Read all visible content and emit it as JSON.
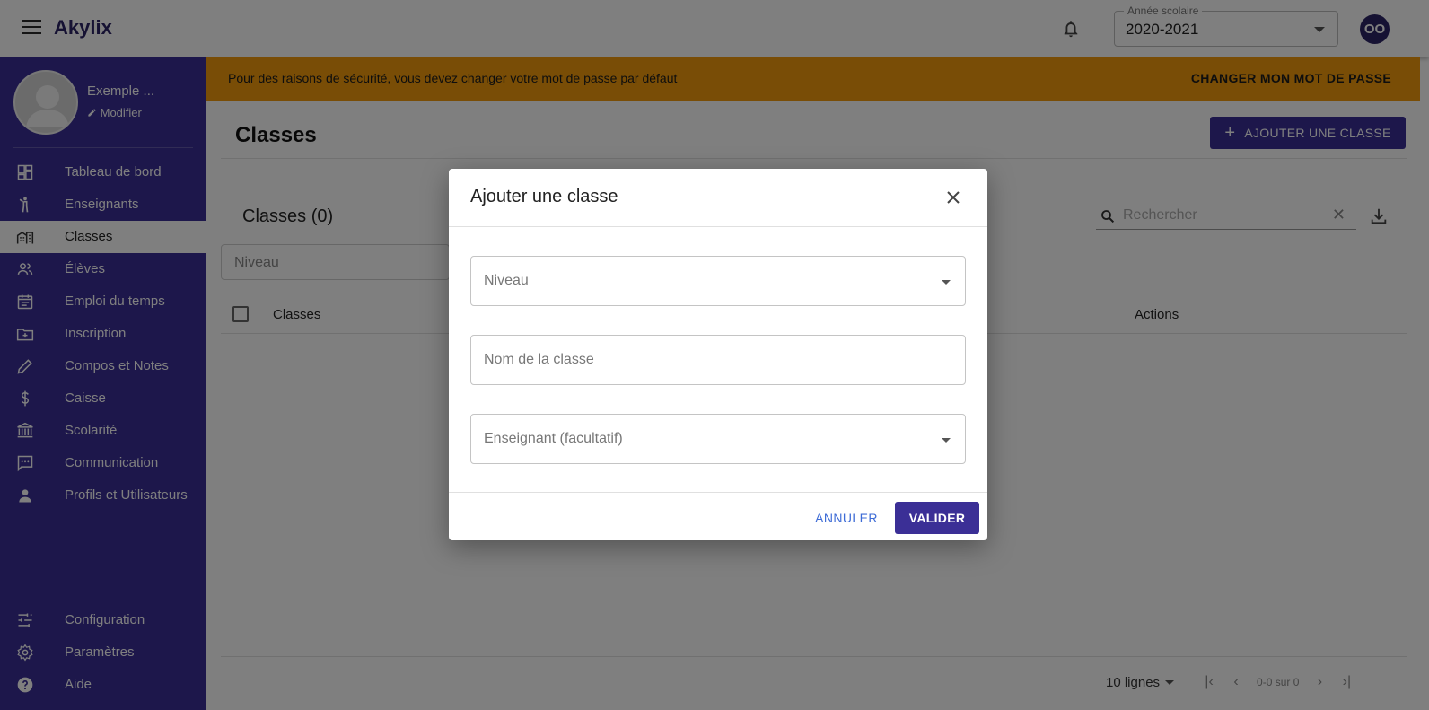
{
  "app": {
    "title": "Akylix"
  },
  "year_select": {
    "label": "Année scolaire",
    "value": "2020-2021"
  },
  "user": {
    "initials": "OO",
    "name": "Exemple ...",
    "edit_label": "Modifier"
  },
  "sidebar": {
    "items": [
      {
        "label": "Tableau de bord",
        "icon": "dashboard-icon"
      },
      {
        "label": "Enseignants",
        "icon": "teacher-icon"
      },
      {
        "label": "Classes",
        "icon": "classes-icon",
        "active": true
      },
      {
        "label": "Élèves",
        "icon": "students-icon"
      },
      {
        "label": "Emploi du temps",
        "icon": "calendar-icon"
      },
      {
        "label": "Inscription",
        "icon": "folder-add-icon"
      },
      {
        "label": "Compos et Notes",
        "icon": "pencil-icon"
      },
      {
        "label": "Caisse",
        "icon": "dollar-icon"
      },
      {
        "label": "Scolarité",
        "icon": "bank-icon"
      },
      {
        "label": "Communication",
        "icon": "chat-icon"
      },
      {
        "label": "Profils et Utilisateurs",
        "icon": "person-icon"
      }
    ],
    "bottom_items": [
      {
        "label": "Configuration",
        "icon": "tune-icon"
      },
      {
        "label": "Paramètres",
        "icon": "gear-icon"
      },
      {
        "label": "Aide",
        "icon": "help-icon"
      }
    ]
  },
  "banner": {
    "text": "Pour des raisons de sécurité, vous devez changer votre mot de passe par défaut",
    "action": "CHANGER MON MOT DE PASSE"
  },
  "main": {
    "title": "Classes",
    "add_button": "AJOUTER UNE CLASSE",
    "table_title": "Classes (0)",
    "search_placeholder": "Rechercher",
    "filter_placeholder": "Niveau",
    "columns": [
      "Classes",
      "Actions"
    ],
    "pagination": {
      "rows": "10 lignes",
      "range": "0-0 sur 0"
    }
  },
  "dialog": {
    "title": "Ajouter une classe",
    "fields": [
      "Niveau",
      "Nom de la classe",
      "Enseignant (facultatif)"
    ],
    "cancel": "ANNULER",
    "confirm": "VALIDER"
  },
  "colors": {
    "primary": "#3b2f96",
    "banner": "#f29a0c",
    "link": "#3d6bd6"
  }
}
